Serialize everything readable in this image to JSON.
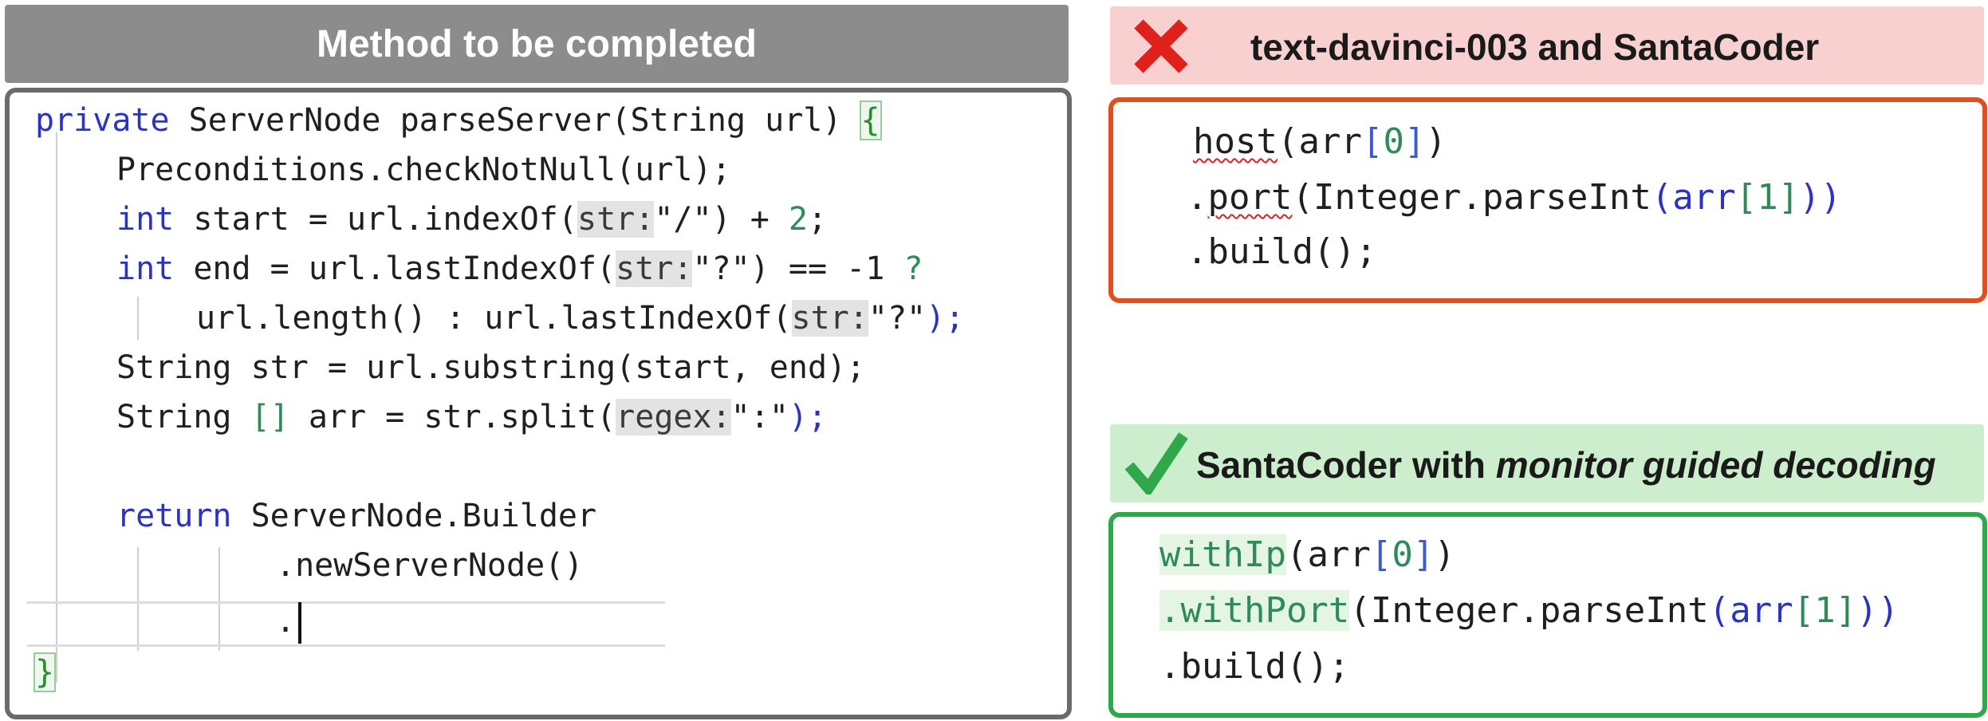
{
  "left": {
    "header": "Method to be completed",
    "lines": [
      {
        "kw": "private",
        "t1": " ServerNode parseServer(String url) ",
        "brace": "{"
      },
      {
        "t": "Preconditions.checkNotNull(url);"
      },
      {
        "kw": "int",
        "t1": " start = url.indexOf(",
        "hint": "str:",
        "q": "\"/\"",
        "t2": ") + ",
        "num": "2",
        "t3": ";"
      },
      {
        "kw": "int",
        "t1": " end = url.lastIndexOf(",
        "hint": "str:",
        "q": "\"?\"",
        "t2": ") == -1 ",
        "op": "?"
      },
      {
        "t1": "url.length() : url.lastIndexOf(",
        "hint": "str:",
        "q": "\"?\"",
        "t2": ");"
      },
      {
        "t": "String str = url.substring(start, end);"
      },
      {
        "t1": "String ",
        "br": "[]",
        "t2": " arr = str.split(",
        "hint": "regex:",
        "q": "\":\"",
        "t3": ");"
      },
      {
        "kw": "return",
        "t1": " ServerNode.Builder"
      },
      {
        "t": ".newServerNode()"
      },
      {
        "t": "."
      },
      {
        "brace": "}"
      }
    ]
  },
  "bad": {
    "header": "text-davinci-003 and SantaCoder",
    "icon": "red-x-icon",
    "color": "#e0501e",
    "lines": [
      {
        "m": "host",
        "p1": "(arr",
        "b1": "[",
        "n": "0",
        "b2": "]",
        "p2": ")"
      },
      {
        "dot": ".",
        "m": "port",
        "p1": "(Integer.parseInt",
        "p2": "(arr",
        "b1": "[",
        "n": "1",
        "b2": "]",
        "p3": "))"
      },
      {
        "t": ".build();"
      }
    ]
  },
  "good": {
    "header_prefix": "SantaCoder with ",
    "header_emph": "monitor guided decoding",
    "icon": "green-check-icon",
    "color": "#2ea84a",
    "lines": [
      {
        "m": "withIp",
        "p1": "(arr",
        "b1": "[",
        "n": "0",
        "b2": "]",
        "p2": ")"
      },
      {
        "m": ".withPort",
        "p1": "(Integer.parseInt",
        "p2": "(arr",
        "b1": "[",
        "n": "1",
        "b2": "]",
        "p3": "))"
      },
      {
        "t": ".build();"
      }
    ]
  }
}
